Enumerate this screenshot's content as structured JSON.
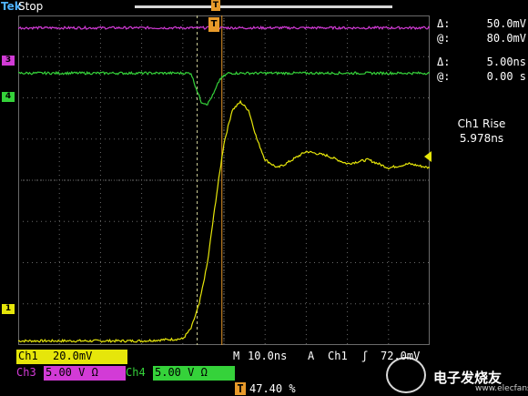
{
  "status": {
    "brand": "Tek",
    "acq_state": "Stop"
  },
  "cursor_readout": {
    "v_delta_label": "Δ:",
    "v_delta": "50.0mV",
    "v_pos_label": "@:",
    "v_pos": "80.0mV",
    "t_delta_label": "Δ:",
    "t_delta": "5.00ns",
    "t_pos_label": "@:",
    "t_pos": "0.00 s"
  },
  "measurement": {
    "name": "Ch1 Rise",
    "value": "5.978ns"
  },
  "channel_markers": {
    "ch1": "1",
    "ch3": "3",
    "ch4": "4"
  },
  "trigger_marker": "T",
  "bottom": {
    "ch1_label": "Ch1",
    "ch1_scale": "20.0mV",
    "ch3_label": "Ch3",
    "ch3_scale": "5.00 V Ω",
    "ch4_label": "Ch4",
    "ch4_scale": "5.00 V Ω",
    "timebase_label": "M",
    "timebase": "10.0ns",
    "trigger_mode": "A",
    "trigger_source": "Ch1",
    "trigger_edge": "ʃ",
    "trigger_level": "72.0mV",
    "trigger_pos_label": "T",
    "trigger_pos": "47.40 %"
  },
  "watermark": {
    "text": "电子发烧友",
    "sub": "www.elecfans.com"
  },
  "colors": {
    "ch1": "#e6e60a",
    "ch3": "#d23bd6",
    "ch4": "#35d23a",
    "trigger": "#e89a2a",
    "grid": "#6a6a6a"
  },
  "chart_data": {
    "type": "line",
    "title": "",
    "xlabel": "",
    "ylabel": "",
    "x_divisions": 10,
    "y_divisions": 8,
    "grid": true,
    "series": [
      {
        "name": "Ch1",
        "unit_x": "div",
        "unit_y": "div",
        "x": [
          0.0,
          1.0,
          2.0,
          3.0,
          4.0,
          4.2,
          4.4,
          4.6,
          4.8,
          5.0,
          5.2,
          5.4,
          5.6,
          5.8,
          6.0,
          6.3,
          6.5,
          7.0,
          7.5,
          8.0,
          8.5,
          9.0,
          9.5,
          10.0
        ],
        "y": [
          -3.9,
          -3.9,
          -3.9,
          -3.9,
          -3.85,
          -3.6,
          -3.0,
          -2.0,
          -0.5,
          0.9,
          1.7,
          1.9,
          1.7,
          1.0,
          0.5,
          0.3,
          0.4,
          0.7,
          0.6,
          0.4,
          0.5,
          0.3,
          0.4,
          0.3
        ]
      },
      {
        "name": "Ch3",
        "unit_x": "div",
        "unit_y": "div",
        "x": [
          0.0,
          10.0
        ],
        "y": [
          3.7,
          3.7
        ]
      },
      {
        "name": "Ch4",
        "unit_x": "div",
        "unit_y": "div",
        "x": [
          0.0,
          4.2,
          4.3,
          4.45,
          4.6,
          4.75,
          4.9,
          5.1,
          10.0
        ],
        "y": [
          2.6,
          2.6,
          2.3,
          1.9,
          1.85,
          2.1,
          2.45,
          2.6,
          2.6
        ]
      }
    ],
    "cursors": {
      "vertical_div": [
        4.35,
        4.95
      ],
      "horizontal_div": [
        1.0,
        -2.5
      ]
    }
  }
}
